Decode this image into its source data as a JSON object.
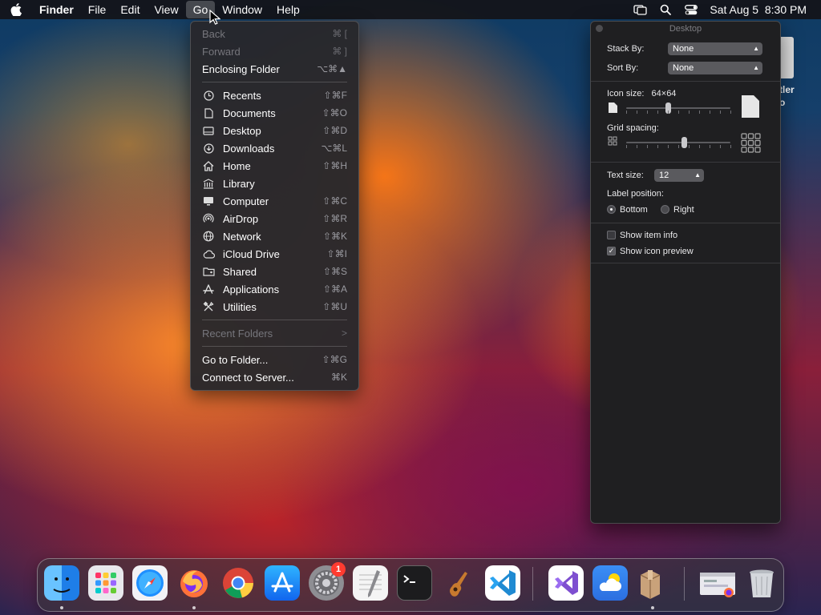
{
  "menubar": {
    "app_name": "Finder",
    "menus": [
      "File",
      "Edit",
      "View",
      "Go",
      "Window",
      "Help"
    ],
    "active_menu": "Go",
    "clock": "Sat Aug 5  8:30 PM"
  },
  "go_menu": {
    "items": [
      {
        "label": "Back",
        "shortcut": "⌘ [",
        "icon": "",
        "disabled": true
      },
      {
        "label": "Forward",
        "shortcut": "⌘ ]",
        "icon": "",
        "disabled": true
      },
      {
        "label": "Enclosing Folder",
        "shortcut": "⌥⌘▲",
        "icon": "",
        "disabled": false
      },
      {
        "label": "Recents",
        "shortcut": "⇧⌘F",
        "icon": "clock-icon",
        "disabled": false
      },
      {
        "label": "Documents",
        "shortcut": "⇧⌘O",
        "icon": "document-icon",
        "disabled": false
      },
      {
        "label": "Desktop",
        "shortcut": "⇧⌘D",
        "icon": "desktop-icon",
        "disabled": false
      },
      {
        "label": "Downloads",
        "shortcut": "⌥⌘L",
        "icon": "download-icon",
        "disabled": false
      },
      {
        "label": "Home",
        "shortcut": "⇧⌘H",
        "icon": "home-icon",
        "disabled": false
      },
      {
        "label": "Library",
        "shortcut": "",
        "icon": "library-icon",
        "disabled": false
      },
      {
        "label": "Computer",
        "shortcut": "⇧⌘C",
        "icon": "computer-icon",
        "disabled": false
      },
      {
        "label": "AirDrop",
        "shortcut": "⇧⌘R",
        "icon": "airdrop-icon",
        "disabled": false
      },
      {
        "label": "Network",
        "shortcut": "⇧⌘K",
        "icon": "network-icon",
        "disabled": false
      },
      {
        "label": "iCloud Drive",
        "shortcut": "⇧⌘I",
        "icon": "cloud-icon",
        "disabled": false
      },
      {
        "label": "Shared",
        "shortcut": "⇧⌘S",
        "icon": "shared-folder-icon",
        "disabled": false
      },
      {
        "label": "Applications",
        "shortcut": "⇧⌘A",
        "icon": "applications-icon",
        "disabled": false
      },
      {
        "label": "Utilities",
        "shortcut": "⇧⌘U",
        "icon": "utilities-icon",
        "disabled": false
      },
      {
        "label": "Recent Folders",
        "shortcut": ">",
        "icon": "",
        "disabled": true
      },
      {
        "label": "Go to Folder...",
        "shortcut": "⇧⌘G",
        "icon": "",
        "disabled": false
      },
      {
        "label": "Connect to Server...",
        "shortcut": "⌘K",
        "icon": "",
        "disabled": false
      }
    ]
  },
  "desktop_item": {
    "label_line1": "tler",
    "label_line2": "o"
  },
  "view_options": {
    "title": "Desktop",
    "stack_by_label": "Stack By:",
    "stack_by_value": "None",
    "sort_by_label": "Sort By:",
    "sort_by_value": "None",
    "icon_size_label": "Icon size:",
    "icon_size_value": "64×64",
    "icon_size_level": 0.4,
    "grid_spacing_label": "Grid spacing:",
    "grid_spacing_level": 0.55,
    "text_size_label": "Text size:",
    "text_size_value": "12",
    "label_position_label": "Label position:",
    "label_position_options": [
      "Bottom",
      "Right"
    ],
    "label_position_selected": "Bottom",
    "show_item_info_label": "Show item info",
    "show_item_info_checked": false,
    "show_icon_preview_label": "Show icon preview",
    "show_icon_preview_checked": true
  },
  "dock": {
    "apps": [
      "Finder",
      "Launchpad",
      "Safari",
      "Firefox",
      "Chrome",
      "App Store",
      "System Settings",
      "TextEdit",
      "Terminal",
      "GarageBand",
      "Visual Studio Code",
      "Visual Studio",
      "Weather",
      "Archive",
      "Downloads Stack",
      "Trash"
    ],
    "settings_badge": "1"
  }
}
